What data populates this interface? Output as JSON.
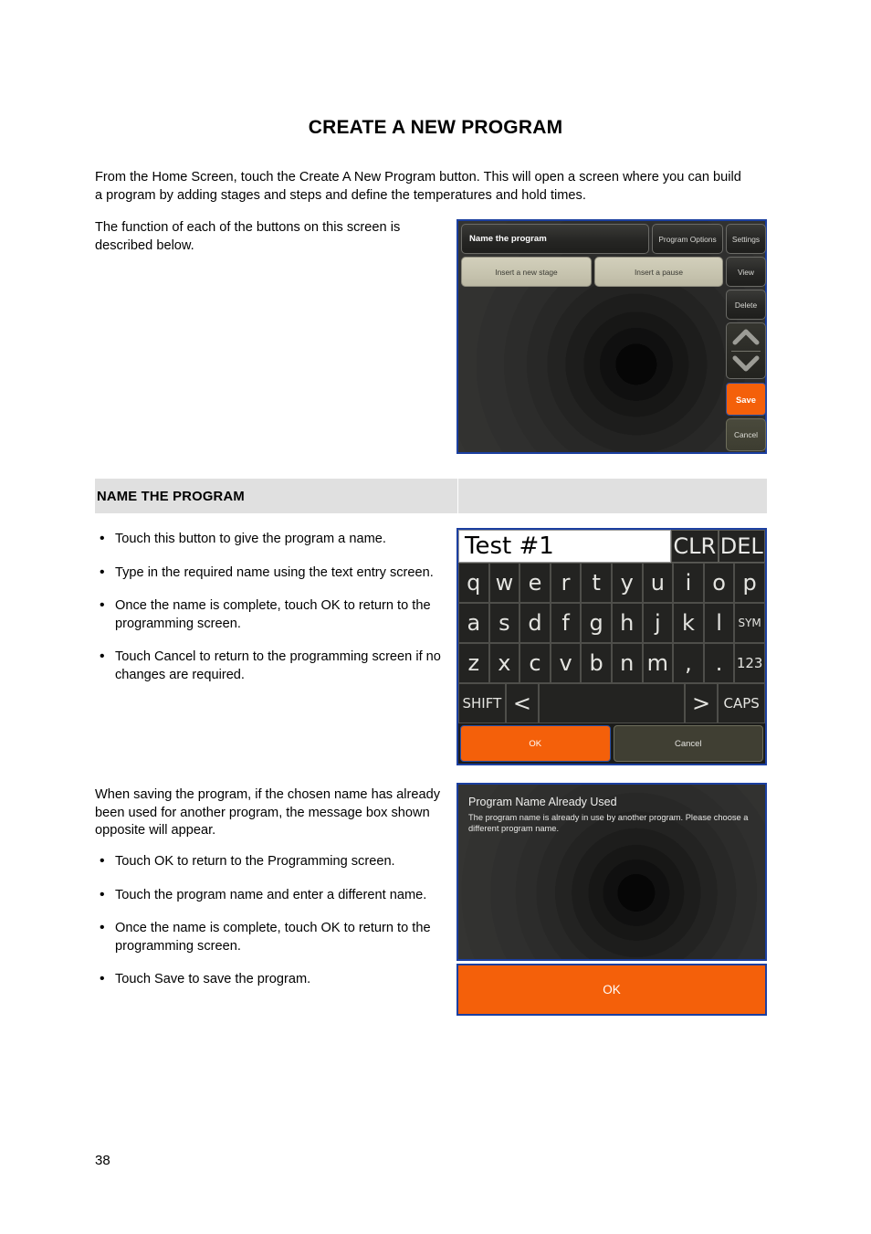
{
  "document": {
    "title": "CREATE A NEW PROGRAM",
    "intro_paragraph": "From the Home Screen, touch the Create A New Program button. This will open a screen where you can build a program by adding stages and steps and define the temperatures and hold times.",
    "function_paragraph": "The function of each of the buttons on this screen is described below.",
    "section_title": "NAME THE PROGRAM",
    "saving_paragraph": "When saving the program, if the chosen name has already been used for another program, the message box shown opposite will appear.",
    "page_number": "38"
  },
  "name_program_bullets": [
    "Touch this button to give the program a name.",
    "Type in the required name using the text entry screen.",
    "Once the name is complete, touch OK to return to the programming screen.",
    "Touch Cancel to return to the programming screen if no changes are required."
  ],
  "duplicate_name_bullets": [
    "Touch OK to return to the Programming screen.",
    "Touch the program name and enter a different name.",
    "Once the name is complete, touch OK to return to the programming screen.",
    "Touch Save to save the program."
  ],
  "editor_screen": {
    "name_the_program": "Name the program",
    "program_options": "Program Options",
    "settings": "Settings",
    "insert_a_new_stage": "Insert a new stage",
    "insert_a_pause": "Insert a pause",
    "view": "View",
    "delete": "Delete",
    "scroll_up_icon": "chevron-up-icon",
    "scroll_down_icon": "chevron-down-icon",
    "save": "Save",
    "cancel": "Cancel"
  },
  "keyboard_screen": {
    "input_value": "Test #1",
    "clr": "CLR",
    "del": "DEL",
    "row1": [
      "q",
      "w",
      "e",
      "r",
      "t",
      "y",
      "u",
      "i",
      "o",
      "p"
    ],
    "row2": [
      "a",
      "s",
      "d",
      "f",
      "g",
      "h",
      "j",
      "k",
      "l",
      "SYM"
    ],
    "row3": [
      "z",
      "x",
      "c",
      "v",
      "b",
      "n",
      "m",
      ",",
      ".",
      "123"
    ],
    "shift": "SHIFT",
    "arrow_left": "<",
    "space": "",
    "arrow_right": ">",
    "caps": "CAPS",
    "ok": "OK",
    "cancel": "Cancel"
  },
  "dialog_screen": {
    "title": "Program Name Already Used",
    "body": "The program name is already in use by another program. Please choose a different program name.",
    "ok": "OK"
  },
  "colors": {
    "accent_orange": "#f4600a",
    "screen_dark": "#2b2b29",
    "key_dark": "#232321",
    "khaki_button": "#c6c3ae",
    "band_gray": "#e0e0e0",
    "screen_border_blue": "#1b3fa0"
  }
}
